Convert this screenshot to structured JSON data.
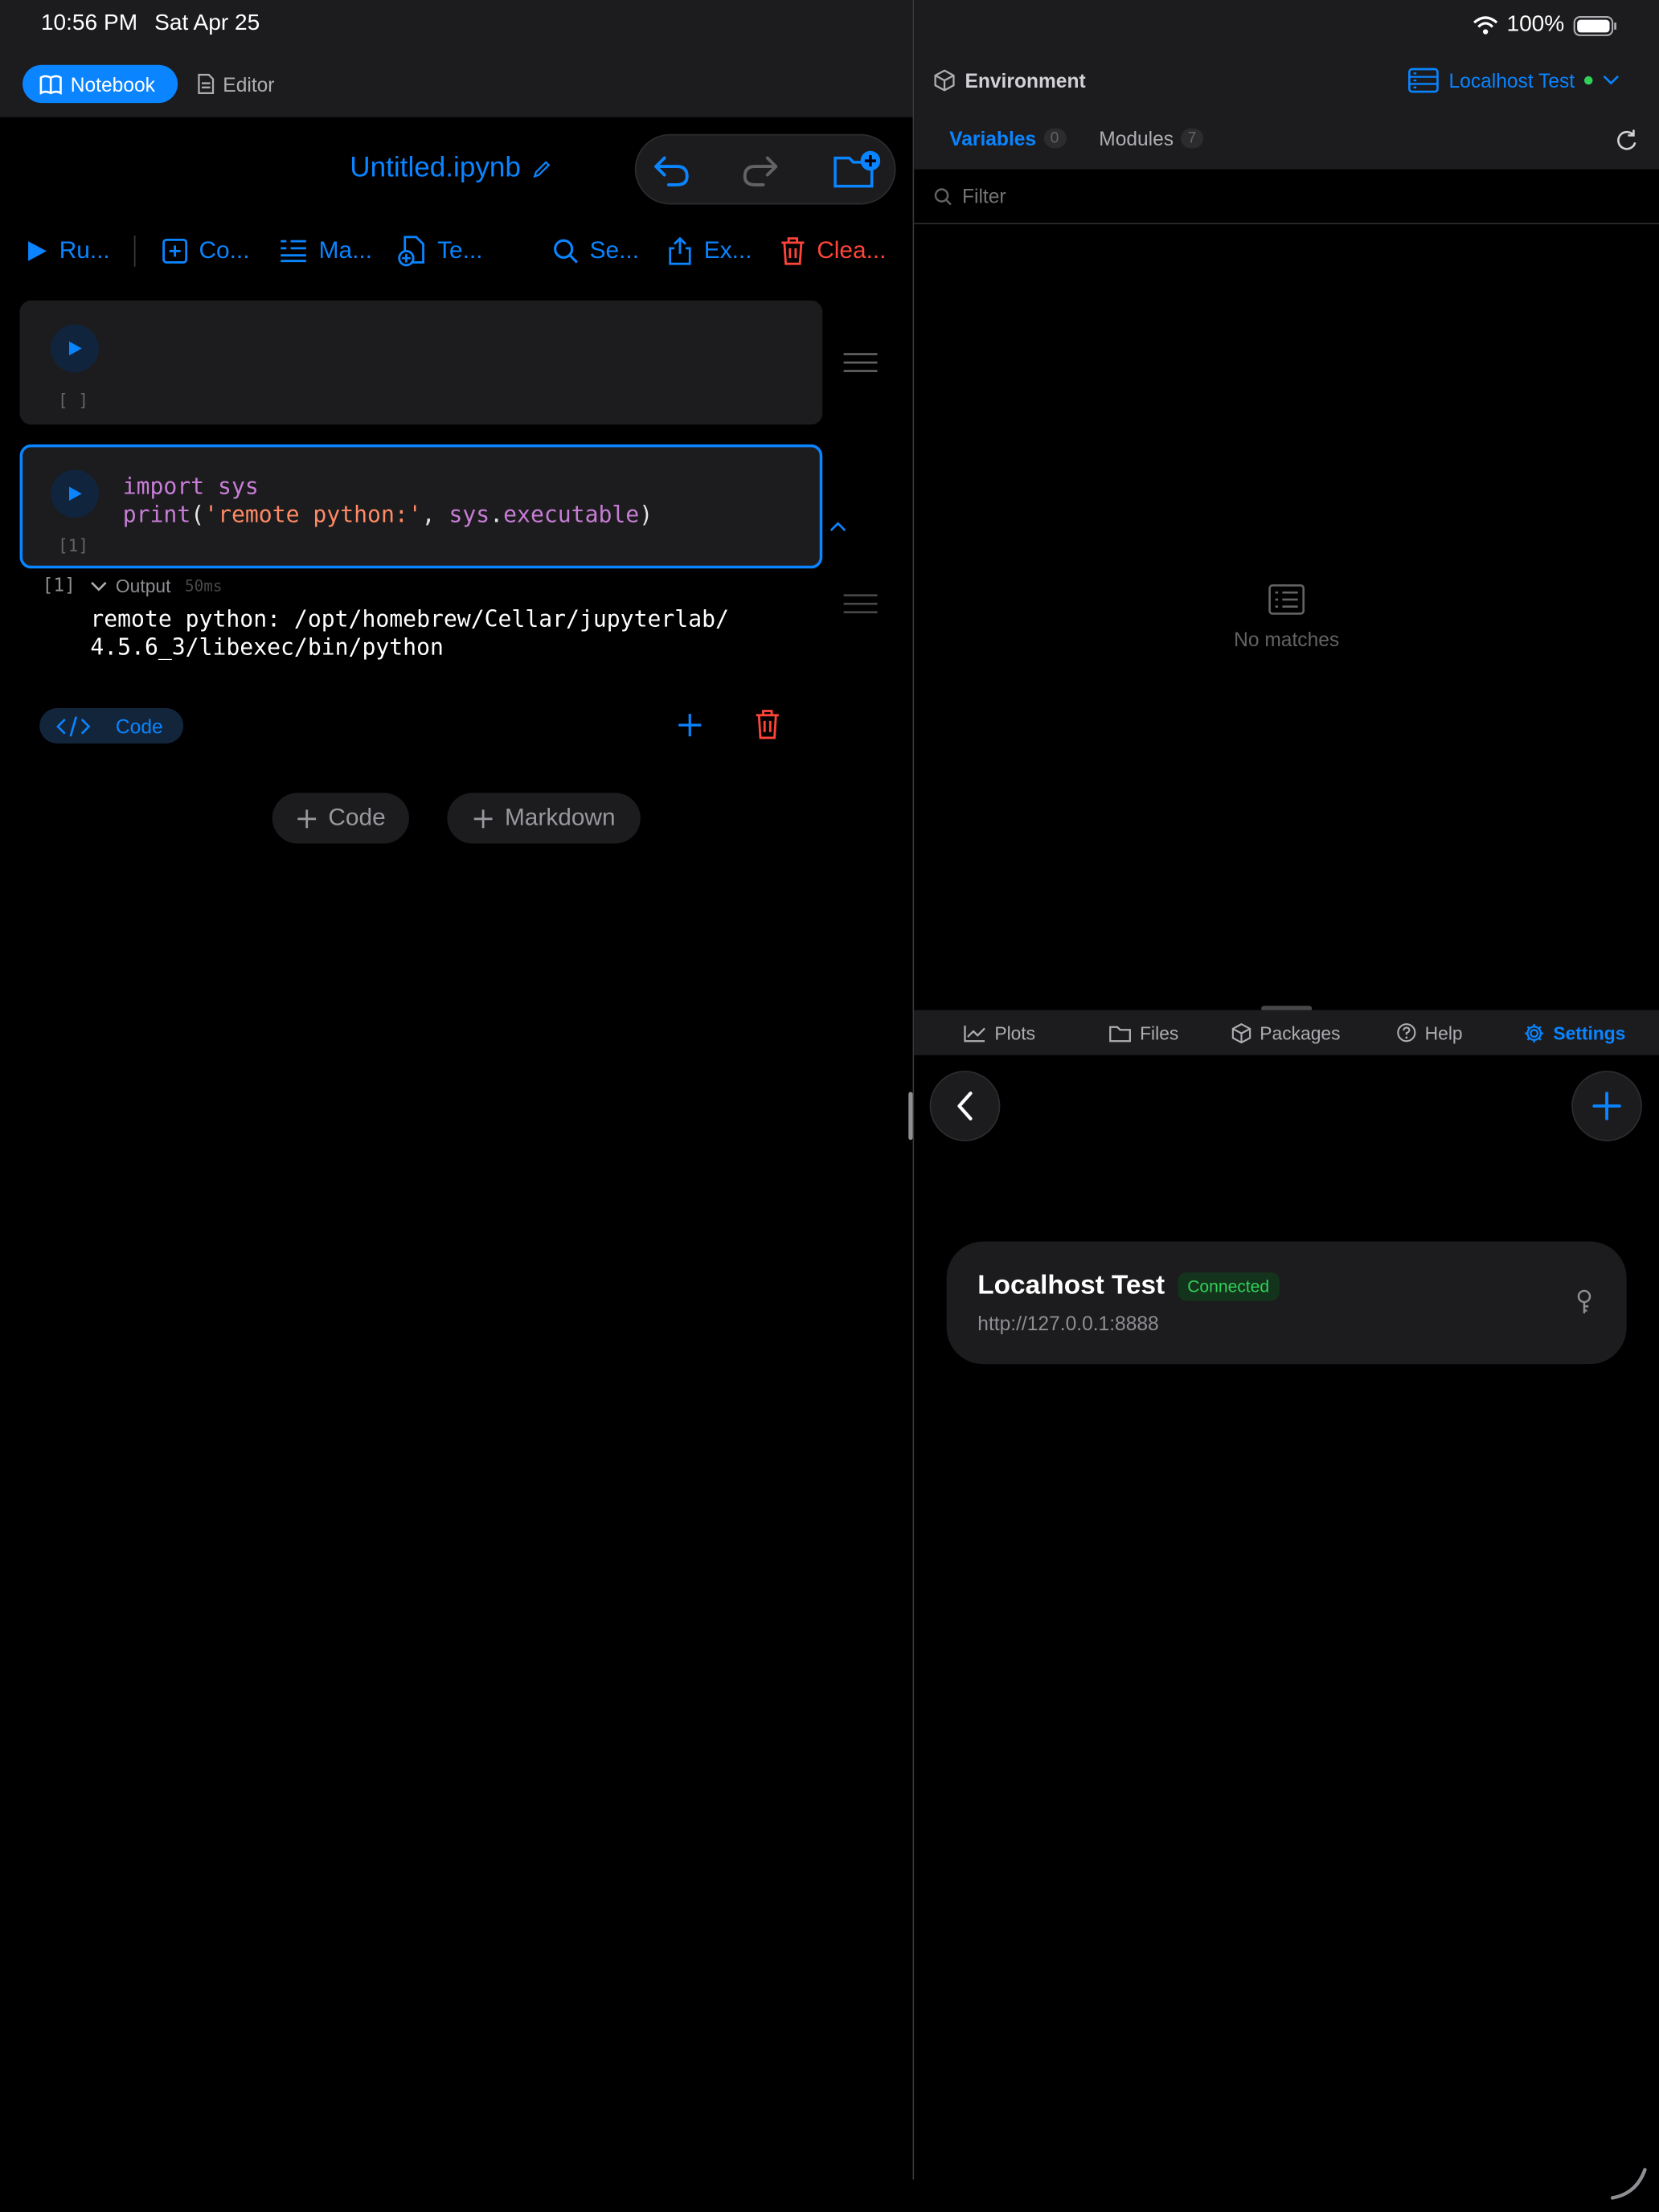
{
  "status_bar": {
    "time": "10:56 PM",
    "date": "Sat Apr 25",
    "battery": "100%"
  },
  "left": {
    "mode_tabs": [
      {
        "label": "Notebook",
        "icon": "book-icon",
        "active": true
      },
      {
        "label": "Editor",
        "icon": "document-icon",
        "active": false
      }
    ],
    "notebook_title": "Untitled.ipynb",
    "toolbar": [
      {
        "label": "Ru...",
        "icon": "play-icon"
      },
      {
        "label": "Co...",
        "icon": "plus-square-icon"
      },
      {
        "label": "Ma...",
        "icon": "markdown-list-icon"
      },
      {
        "label": "Te...",
        "icon": "template-icon"
      },
      {
        "label": "Se...",
        "icon": "search-icon"
      },
      {
        "label": "Ex...",
        "icon": "share-icon"
      },
      {
        "label": "Clea...",
        "icon": "trash-icon"
      }
    ],
    "cells": [
      {
        "exec_count": "[ ]",
        "code_lines": []
      },
      {
        "exec_count": "[1]",
        "code_line1_kw": "import",
        "code_line1_mod": "sys",
        "code_line2_fn": "print",
        "code_line2_str": "'remote python:'",
        "code_line2_attr_obj": "sys",
        "code_line2_attr": "executable"
      }
    ],
    "output": {
      "exec_count": "[1]",
      "label": "Output",
      "duration": "50ms",
      "line1": "remote python: /opt/homebrew/Cellar/jupyterlab/",
      "line2": "4.5.6_3/libexec/bin/python"
    },
    "cell_type_label": "Code",
    "add_code_label": "Code",
    "add_markdown_label": "Markdown"
  },
  "right": {
    "header_title": "Environment",
    "server_name": "Localhost Test",
    "tabs": [
      {
        "label": "Variables",
        "count": "0",
        "active": true
      },
      {
        "label": "Modules",
        "count": "7",
        "active": false
      }
    ],
    "filter_placeholder": "Filter",
    "empty_text": "No matches",
    "bottom_tabs": [
      {
        "label": "Plots",
        "icon": "chart-line-icon",
        "active": false
      },
      {
        "label": "Files",
        "icon": "folder-icon",
        "active": false
      },
      {
        "label": "Packages",
        "icon": "package-icon",
        "active": false
      },
      {
        "label": "Help",
        "icon": "help-circle-icon",
        "active": false
      },
      {
        "label": "Settings",
        "icon": "gear-icon",
        "active": true
      }
    ],
    "server_card": {
      "name": "Localhost Test",
      "status": "Connected",
      "url": "http://127.0.0.1:8888"
    }
  },
  "colors": {
    "accent": "#0a84ff",
    "danger": "#ff453a",
    "success": "#30d158",
    "code_keyword": "#c77dd6",
    "code_string": "#ff8a65"
  }
}
